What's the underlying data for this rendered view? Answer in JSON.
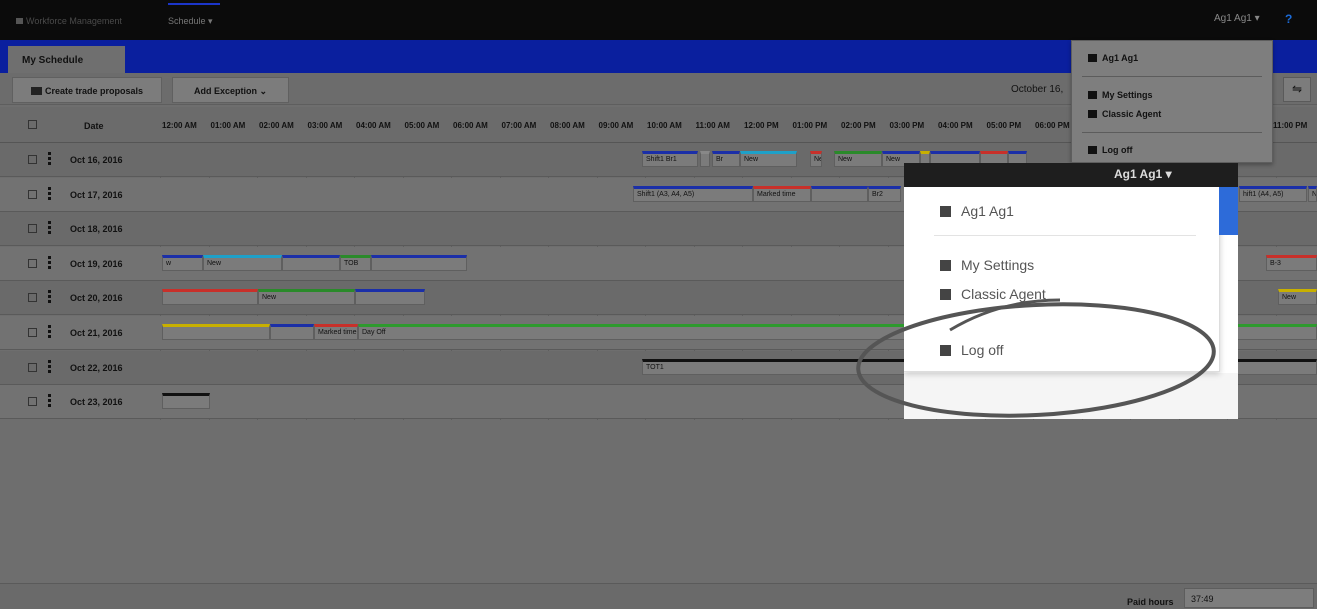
{
  "app": {
    "title": "Workforce Management",
    "top_menu": "Schedule ▾",
    "user": "Ag1 Ag1 ▾",
    "help": "?"
  },
  "tab": {
    "label": "My Schedule"
  },
  "toolbar": {
    "trade_label": "Create trade proposals",
    "exception_label": "Add Exception ⌄",
    "date": "October 16,",
    "filter_icon": "⇋"
  },
  "grid": {
    "date_header": "Date",
    "hours": [
      "12:00 AM",
      "01:00 AM",
      "02:00 AM",
      "03:00 AM",
      "04:00 AM",
      "05:00 AM",
      "06:00 AM",
      "07:00 AM",
      "08:00 AM",
      "09:00 AM",
      "10:00 AM",
      "11:00 AM",
      "12:00 PM",
      "01:00 PM",
      "02:00 PM",
      "03:00 PM",
      "04:00 PM",
      "05:00 PM",
      "06:00 PM",
      "11:00 PM"
    ],
    "rows": [
      {
        "date": "Oct 16, 2016",
        "segments": [
          {
            "label": "Shift1 Br1",
            "color": "#1b2fa8"
          },
          {
            "label": "",
            "color": "#888"
          },
          {
            "label": "Br",
            "color": "#1b2fa8"
          },
          {
            "label": "New",
            "color": "#1ea0c8"
          },
          {
            "label": "Ne",
            "color": "#c8302a"
          },
          {
            "label": "New",
            "color": "#2a8a2a"
          },
          {
            "label": "New",
            "color": "#1b2fa8"
          },
          {
            "label": "",
            "color": "#c8b000"
          },
          {
            "label": "",
            "color": "#1b2fa8"
          },
          {
            "label": "",
            "color": "#c8302a"
          },
          {
            "label": "",
            "color": "#1b2fa8"
          }
        ]
      },
      {
        "date": "Oct 17, 2016",
        "segments": [
          {
            "label": "Shift1 (A3, A4, A5)",
            "color": "#1b2fa8"
          },
          {
            "label": "Marked time",
            "color": "#c8302a"
          },
          {
            "label": "",
            "color": "#1b2fa8"
          },
          {
            "label": "Br2",
            "color": "#1b2fa8"
          },
          {
            "label": "hift1 (A4, A5)",
            "color": "#1b2fa8"
          },
          {
            "label": "Ne",
            "color": "#1b2fa8"
          }
        ]
      },
      {
        "date": "Oct 18, 2016",
        "segments": []
      },
      {
        "date": "Oct 19, 2016",
        "segments": [
          {
            "label": "w",
            "color": "#1b2fa8"
          },
          {
            "label": "New",
            "color": "#1ea0c8"
          },
          {
            "label": "",
            "color": "#1b2fa8"
          },
          {
            "label": "TOB",
            "color": "#2a8a2a"
          },
          {
            "label": "",
            "color": "#1b2fa8"
          },
          {
            "label": "B-3",
            "color": "#c8302a"
          }
        ]
      },
      {
        "date": "Oct 20, 2016",
        "segments": [
          {
            "label": "",
            "color": "#c8302a"
          },
          {
            "label": "New",
            "color": "#2a8a2a"
          },
          {
            "label": "",
            "color": "#1b2fa8"
          },
          {
            "label": "New",
            "color": "#c8b000"
          }
        ]
      },
      {
        "date": "Oct 21, 2016",
        "segments": [
          {
            "label": "",
            "color": "#c8b000"
          },
          {
            "label": "",
            "color": "#1b2fa8"
          },
          {
            "label": "Marked time",
            "color": "#c8302a"
          },
          {
            "label": "Day Off",
            "color": "#2e9a2e"
          }
        ]
      },
      {
        "date": "Oct 22, 2016",
        "segments": [
          {
            "label": "TOT1",
            "color": "#111"
          }
        ]
      },
      {
        "date": "Oct 23, 2016",
        "segments": [
          {
            "label": "",
            "color": "#111"
          }
        ]
      }
    ]
  },
  "user_menu": {
    "name": "Ag1 Ag1",
    "settings": "My Settings",
    "classic": "Classic Agent",
    "logoff": "Log off"
  },
  "zoom": {
    "user": "Ag1 Ag1 ▾",
    "name": "Ag1 Ag1",
    "settings": "My Settings",
    "classic": "Classic Agent",
    "logoff": "Log off"
  },
  "footer": {
    "paid_label": "Paid hours",
    "paid_value": "37:49"
  }
}
